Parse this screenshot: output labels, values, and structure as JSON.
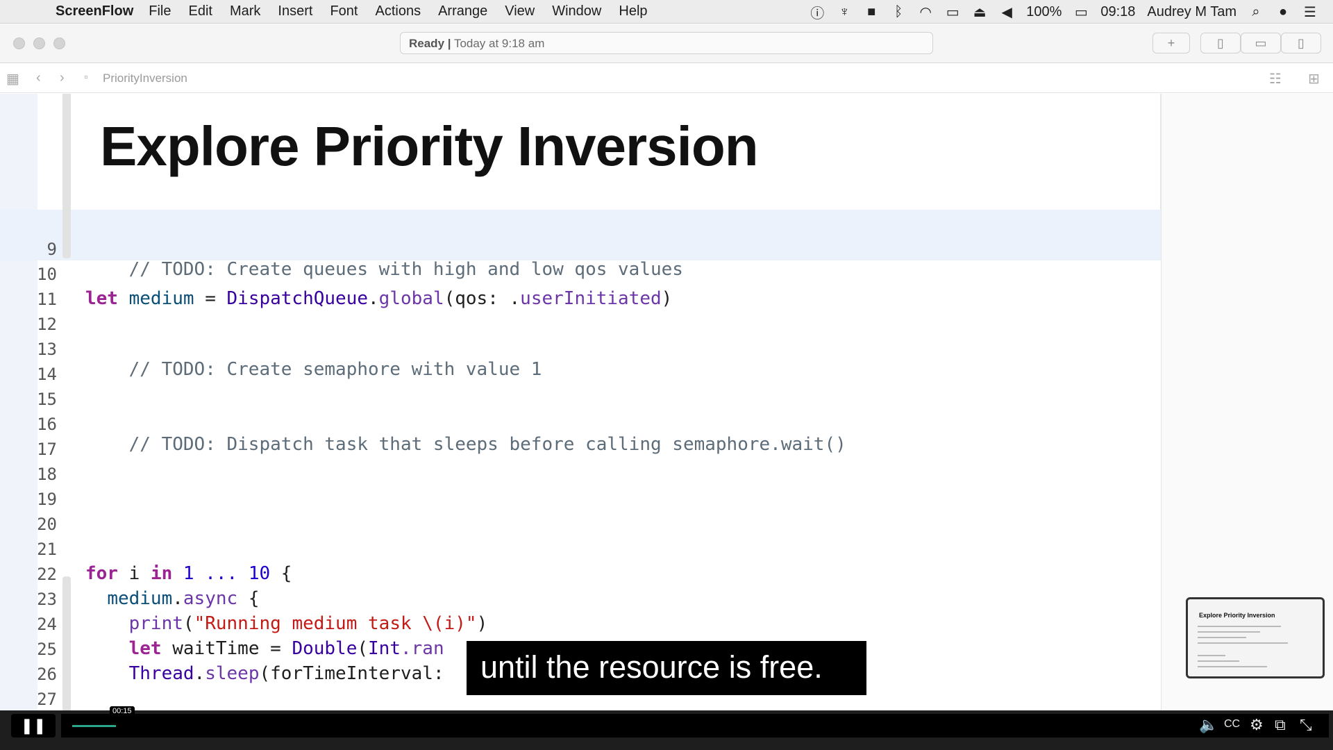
{
  "menubar": {
    "apple_icon": "",
    "app_name": "ScreenFlow",
    "menus": [
      "File",
      "Edit",
      "Mark",
      "Insert",
      "Font",
      "Actions",
      "Arrange",
      "View",
      "Window",
      "Help"
    ],
    "battery": "100%",
    "time": "09:18",
    "user": "Audrey M Tam"
  },
  "titlebar": {
    "status_ready": "Ready |",
    "status_time": "Today at 9:18 am",
    "add_label": "+"
  },
  "jumpbar": {
    "file_name": "PriorityInversion"
  },
  "editor": {
    "heading": "Explore Priority Inversion",
    "lines": [
      {
        "n": "9"
      },
      {
        "n": "10"
      },
      {
        "n": "11"
      },
      {
        "n": "12"
      },
      {
        "n": "13"
      },
      {
        "n": "14"
      },
      {
        "n": "15"
      },
      {
        "n": "16"
      },
      {
        "n": "17"
      },
      {
        "n": "18"
      },
      {
        "n": "19"
      },
      {
        "n": "20"
      },
      {
        "n": "21"
      },
      {
        "n": "22"
      },
      {
        "n": "23"
      },
      {
        "n": "24"
      },
      {
        "n": "25"
      },
      {
        "n": "26"
      },
      {
        "n": "27"
      }
    ],
    "code": {
      "l9": "// TODO: Create queues with high and low qos values",
      "l11_let": "let",
      "l11_name": "medium",
      "l11_eq": " = ",
      "l11_type": "DispatchQueue",
      "l11_dot": ".",
      "l11_fn": "global",
      "l11_args": "(qos: .",
      "l11_val": "userInitiated",
      "l11_close": ")",
      "l13": "// TODO: Create semaphore with value 1",
      "l16": "// TODO: Dispatch task that sleeps before calling semaphore.wait()",
      "l22_for": "for",
      "l22_i": " i ",
      "l22_in": "in",
      "l22_sp": " ",
      "l22_1": "1",
      "l22_range": " ... ",
      "l22_10": "10",
      "l22_brace": " {",
      "l23_indent": "  ",
      "l23_obj": "medium",
      "l23_dot": ".",
      "l23_fn": "async",
      "l23_brace": " {",
      "l24_indent": "    ",
      "l24_fn": "print",
      "l24_open": "(",
      "l24_str": "\"Running medium task \\(i)\"",
      "l24_close": ")",
      "l25_indent": "    ",
      "l25_let": "let",
      "l25_name": " waitTime = ",
      "l25_type": "Double",
      "l25_open": "(",
      "l25_type2": "Int",
      "l25_rest": ".ran",
      "l26_indent": "    ",
      "l26_type": "Thread",
      "l26_dot": ".",
      "l26_fn": "sleep",
      "l26_rest": "(forTimeInterval:",
      "l27": "  }"
    }
  },
  "caption": "until the resource is free.",
  "thumbnail": {
    "title": "Explore Priority Inversion"
  },
  "player": {
    "pause_icon": "❚❚",
    "timestamp": "00:15",
    "progress": 0.035
  }
}
